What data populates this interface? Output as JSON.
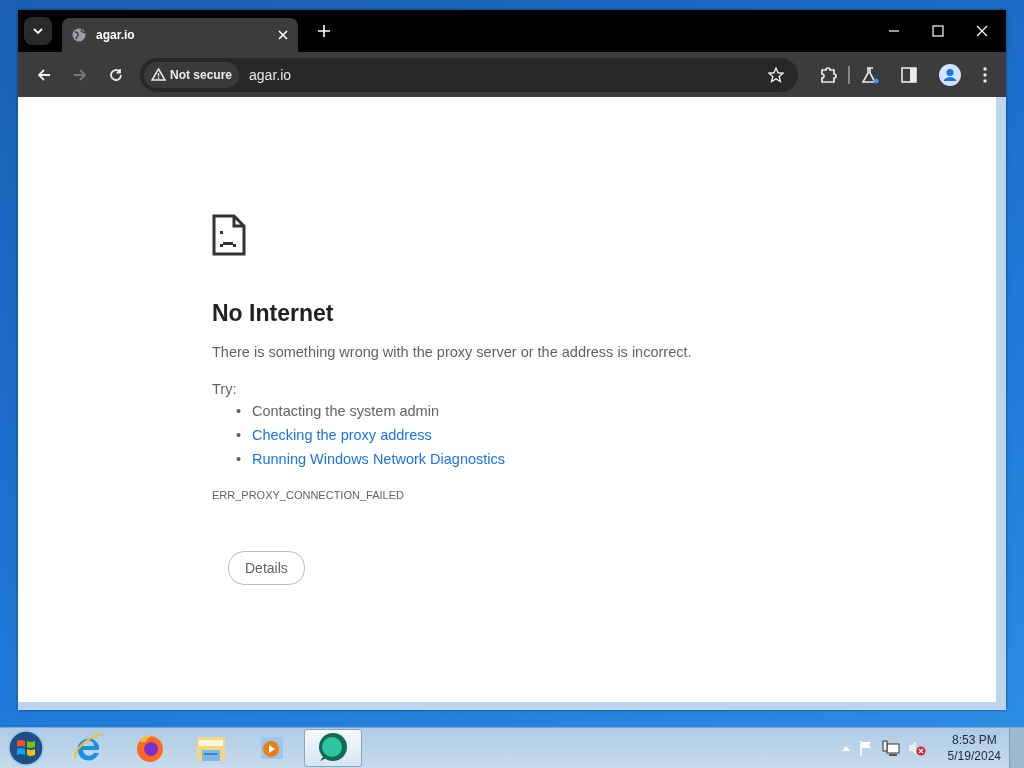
{
  "tab": {
    "title": "agar.io",
    "selected": true
  },
  "address": {
    "security": "Not secure",
    "url": "agar.io"
  },
  "page": {
    "title": "No Internet",
    "message": "There is something wrong with the proxy server or the address is incorrect.",
    "try_label": "Try:",
    "suggestions": [
      {
        "bullet": "•",
        "text": "Contacting the system admin",
        "kind": "text"
      },
      {
        "bullet": "•",
        "text": "Checking the proxy address",
        "kind": "link"
      },
      {
        "bullet": "•",
        "text": "Running Windows Network Diagnostics",
        "kind": "link"
      }
    ],
    "error_code": "ERR_PROXY_CONNECTION_FAILED",
    "details_button": "Details"
  },
  "taskbar": {
    "apps": [
      {
        "kind": "ie",
        "selected": false
      },
      {
        "kind": "firefox",
        "selected": false
      },
      {
        "kind": "folder",
        "selected": false
      },
      {
        "kind": "media",
        "selected": false
      },
      {
        "kind": "chat",
        "selected": true
      }
    ],
    "clock": {
      "time": "8:53 PM",
      "date": "5/19/2024"
    }
  }
}
